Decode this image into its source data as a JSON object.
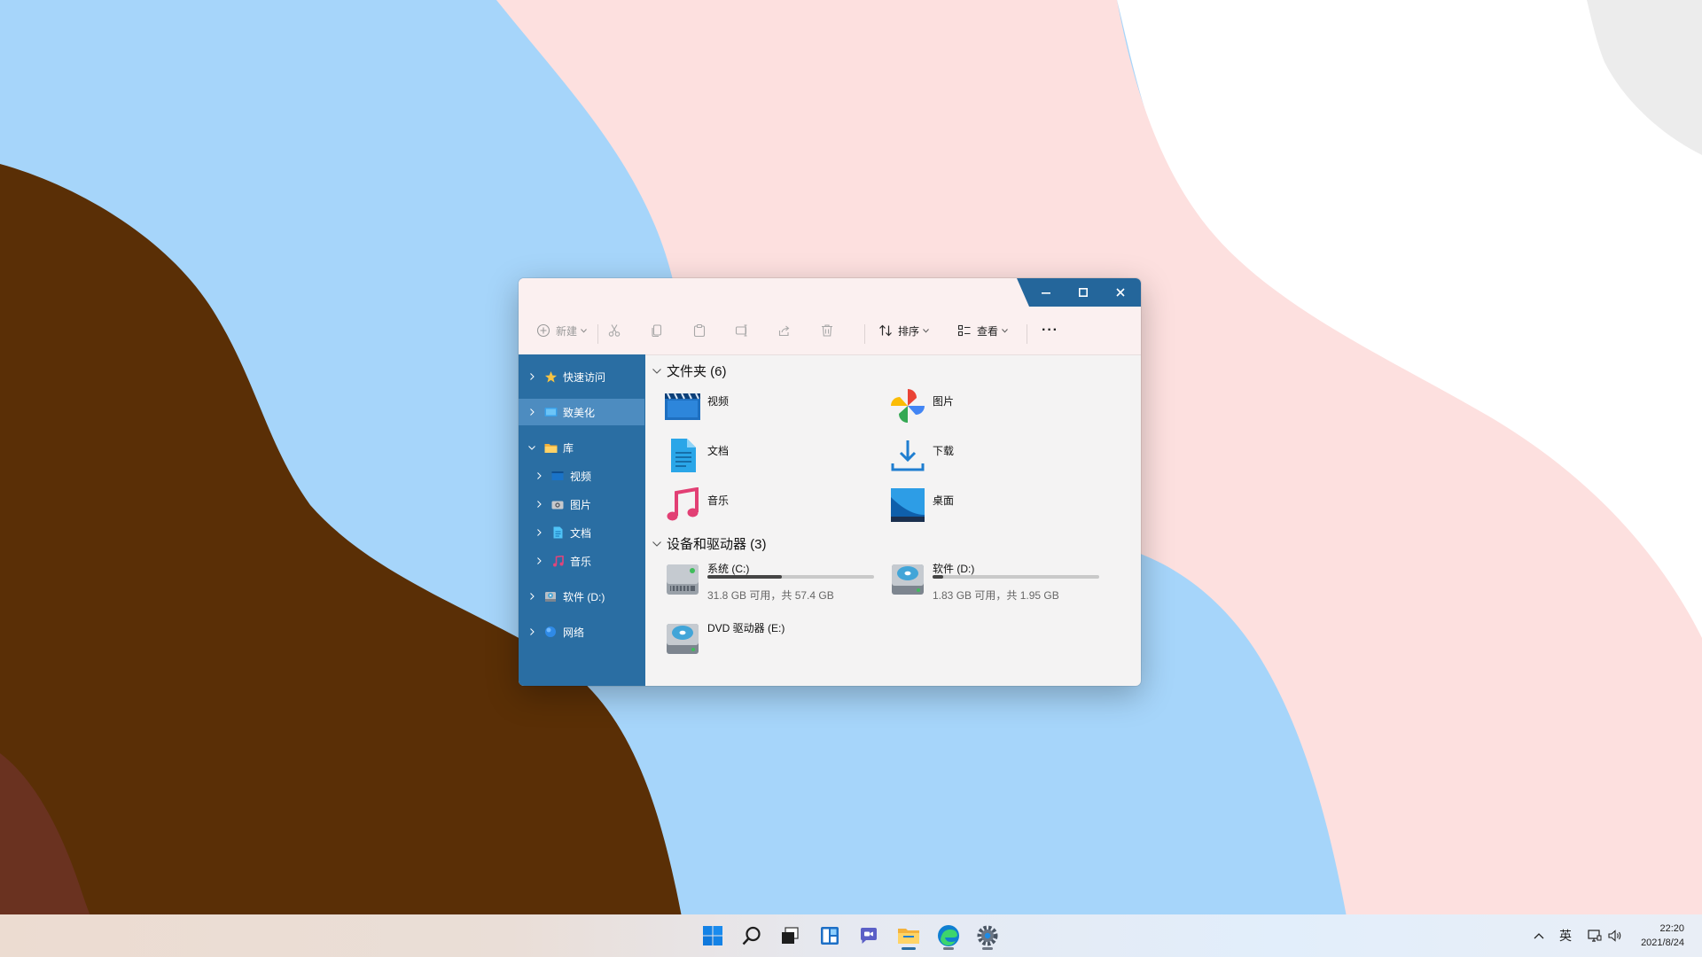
{
  "window": {
    "toolbar": {
      "new_label": "新建",
      "sort_label": "排序",
      "view_label": "查看",
      "more_label": "···"
    },
    "sidebar": {
      "items": [
        {
          "label": "快速访问"
        },
        {
          "label": "致美化"
        },
        {
          "label": "库"
        },
        {
          "label": "视频"
        },
        {
          "label": "图片"
        },
        {
          "label": "文档"
        },
        {
          "label": "音乐"
        },
        {
          "label": "软件 (D:)"
        },
        {
          "label": "网络"
        }
      ]
    },
    "folders_section": {
      "title": "文件夹 (6)",
      "items": [
        {
          "name": "视频"
        },
        {
          "name": "图片"
        },
        {
          "name": "文档"
        },
        {
          "name": "下载"
        },
        {
          "name": "音乐"
        },
        {
          "name": "桌面"
        }
      ]
    },
    "devices_section": {
      "title": "设备和驱动器 (3)",
      "drives": [
        {
          "name": "系统 (C:)",
          "free_text": "31.8 GB 可用，共 57.4 GB",
          "used_fraction": 0.446
        },
        {
          "name": "软件 (D:)",
          "free_text": "1.83 GB 可用，共 1.95 GB",
          "used_fraction": 0.062
        },
        {
          "name": "DVD 驱动器 (E:)"
        }
      ]
    }
  },
  "taskbar": {
    "apps": [
      "start-icon",
      "search-icon",
      "task-view-icon",
      "widgets-icon",
      "chat-icon",
      "file-explorer-icon",
      "edge-icon",
      "settings-icon"
    ],
    "tray": {
      "ime": "英",
      "time": "22:20",
      "date": "2021/8/24"
    }
  },
  "colors": {
    "sidebar": "#2a6ea3",
    "sidebar_selected": "#4d8cc0",
    "titlebar": "#fbf0f0",
    "caption": "#24669b"
  }
}
